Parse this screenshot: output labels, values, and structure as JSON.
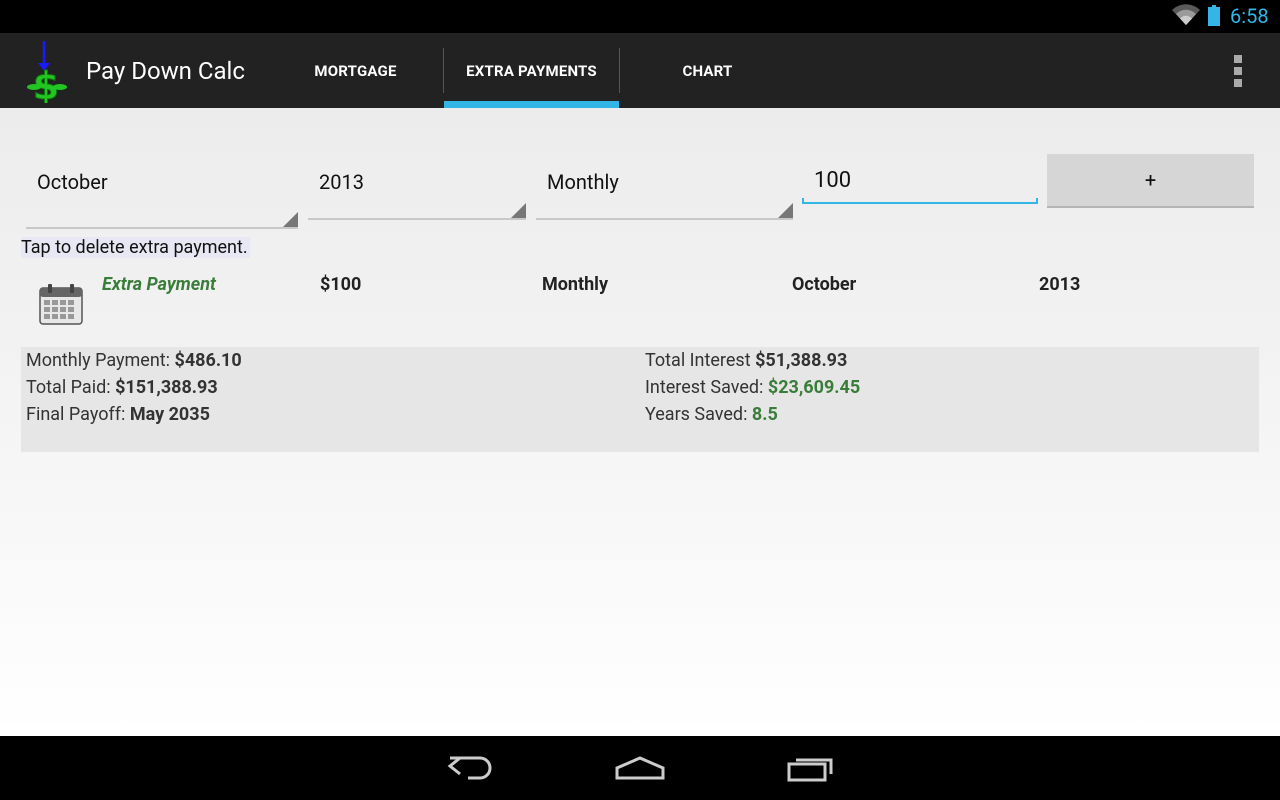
{
  "status_bar": {
    "time": "6:58"
  },
  "action_bar": {
    "title": "Pay Down Calc",
    "tabs": [
      {
        "label": "MORTGAGE",
        "selected": false
      },
      {
        "label": "EXTRA PAYMENTS",
        "selected": true
      },
      {
        "label": "CHART",
        "selected": false
      }
    ]
  },
  "form": {
    "month": "October",
    "year": "2013",
    "frequency": "Monthly",
    "amount": "100",
    "add_label": "+"
  },
  "hint": "Tap to delete extra payment.",
  "extra_payment_row": {
    "title": "Extra Payment",
    "amount": "$100",
    "frequency": "Monthly",
    "month": "October",
    "year": "2013"
  },
  "summary": {
    "monthly_payment_label": "Monthly Payment:",
    "monthly_payment_value": "$486.10",
    "total_paid_label": "Total Paid:",
    "total_paid_value": "$151,388.93",
    "final_payoff_label": "Final Payoff:",
    "final_payoff_value": "May 2035",
    "total_interest_label": "Total Interest",
    "total_interest_value": "$51,388.93",
    "interest_saved_label": "Interest Saved:",
    "interest_saved_value": "$23,609.45",
    "years_saved_label": "Years Saved:",
    "years_saved_value": "8.5"
  },
  "colors": {
    "accent": "#33b5e5",
    "green": "#3a7d3a",
    "action_bar": "#222222"
  },
  "icons": [
    "wifi-icon",
    "battery-icon",
    "app-icon",
    "overflow-menu-icon",
    "calendar-icon",
    "back-icon",
    "home-icon",
    "recents-icon"
  ]
}
